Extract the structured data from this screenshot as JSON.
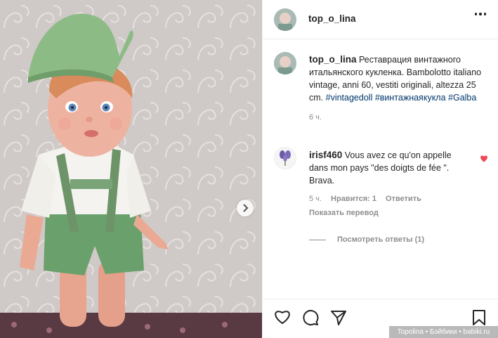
{
  "post": {
    "author": "top_o_lina",
    "caption_text": "Реставрация винтажного итальянского кукленка. Bambolotto italiano vintage, anni 60, vestiti originali, altezza 25 cm.",
    "tags": [
      "#vintagedoll",
      "#винтажнаякукла",
      "#Galba"
    ],
    "time": "6 ч."
  },
  "comment": {
    "author": "irisf460",
    "text": "Vous avez ce qu'on appelle dans mon pays \"des doigts de fée \". Brava.",
    "time": "5 ч.",
    "likes": "Нравится: 1",
    "reply": "Ответить",
    "translate": "Показать перевод",
    "view_replies": "Посмотреть ответы (1)"
  },
  "watermark": "Topolina • Бэйбики • babiki.ru",
  "icons": [
    "more-icon",
    "heart-icon",
    "comment-icon",
    "share-icon",
    "bookmark-icon",
    "chevron-right-icon"
  ],
  "colors": {
    "like_red": "#ed4956",
    "hashtag": "#00376b",
    "muted": "#8e8e8e",
    "text": "#262626"
  }
}
